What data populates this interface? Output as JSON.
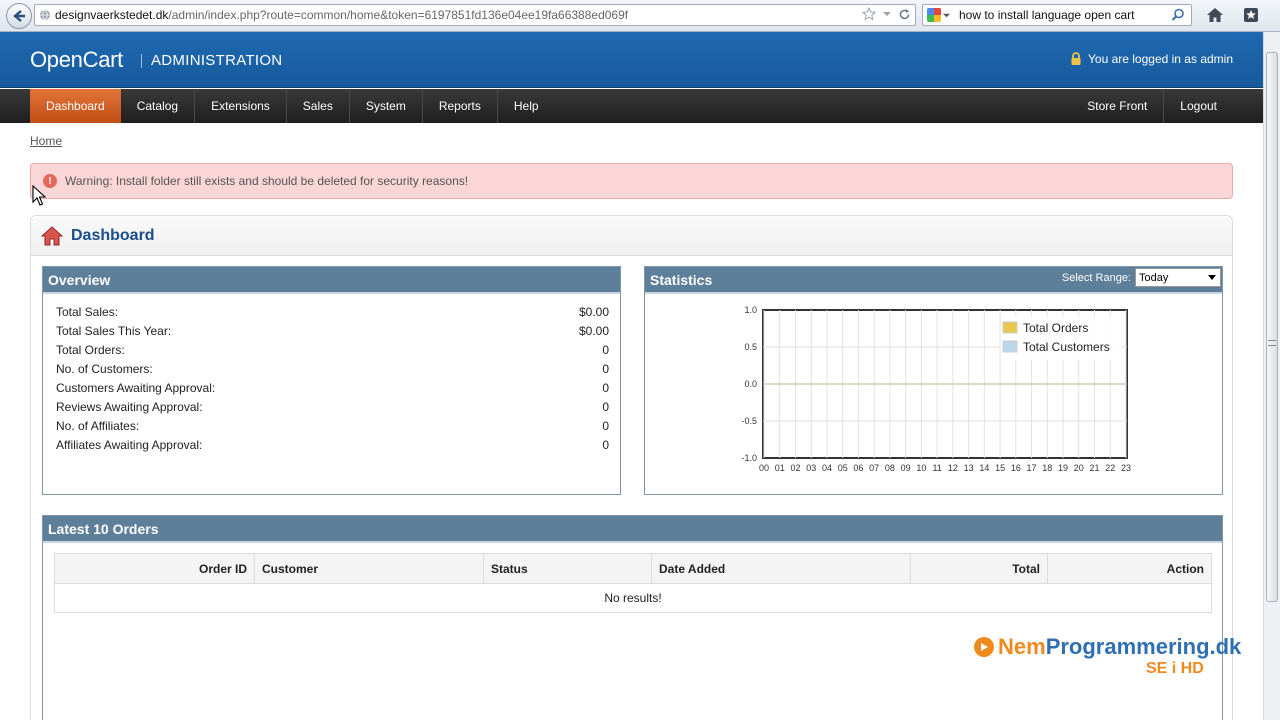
{
  "browser": {
    "url_domain": "designvaerkstedet.dk",
    "url_path": "/admin/index.php?route=common/home&token=6197851fd136e04ee19fa66388ed069f",
    "search_text": "how to install language open cart"
  },
  "header": {
    "logo": "OpenCart",
    "admin": "ADMINISTRATION",
    "login_text": "You are logged in as admin"
  },
  "menu": {
    "left": [
      "Dashboard",
      "Catalog",
      "Extensions",
      "Sales",
      "System",
      "Reports",
      "Help"
    ],
    "right": [
      "Store Front",
      "Logout"
    ],
    "active": "Dashboard"
  },
  "breadcrumb": "Home",
  "warning": "Warning: Install folder still exists and should be deleted for security reasons!",
  "dashboard": {
    "title": "Dashboard"
  },
  "overview": {
    "title": "Overview",
    "rows": [
      {
        "label": "Total Sales:",
        "value": "$0.00"
      },
      {
        "label": "Total Sales This Year:",
        "value": "$0.00"
      },
      {
        "label": "Total Orders:",
        "value": "0"
      },
      {
        "label": "No. of Customers:",
        "value": "0"
      },
      {
        "label": "Customers Awaiting Approval:",
        "value": "0"
      },
      {
        "label": "Reviews Awaiting Approval:",
        "value": "0"
      },
      {
        "label": "No. of Affiliates:",
        "value": "0"
      },
      {
        "label": "Affiliates Awaiting Approval:",
        "value": "0"
      }
    ]
  },
  "statistics": {
    "title": "Statistics",
    "range_label": "Select Range:",
    "range_value": "Today"
  },
  "chart_data": {
    "type": "line",
    "x": [
      "00",
      "01",
      "02",
      "03",
      "04",
      "05",
      "06",
      "07",
      "08",
      "09",
      "10",
      "11",
      "12",
      "13",
      "14",
      "15",
      "16",
      "17",
      "18",
      "19",
      "20",
      "21",
      "22",
      "23"
    ],
    "series": [
      {
        "name": "Total Orders",
        "color": "#e8c84c",
        "values": [
          0,
          0,
          0,
          0,
          0,
          0,
          0,
          0,
          0,
          0,
          0,
          0,
          0,
          0,
          0,
          0,
          0,
          0,
          0,
          0,
          0,
          0,
          0,
          0
        ]
      },
      {
        "name": "Total Customers",
        "color": "#b8d6ec",
        "values": [
          0,
          0,
          0,
          0,
          0,
          0,
          0,
          0,
          0,
          0,
          0,
          0,
          0,
          0,
          0,
          0,
          0,
          0,
          0,
          0,
          0,
          0,
          0,
          0
        ]
      }
    ],
    "yticks": [
      "1.0",
      "0.5",
      "0.0",
      "-0.5",
      "-1.0"
    ],
    "ylim": [
      -1,
      1
    ],
    "grid": true,
    "legend": "top-right"
  },
  "orders": {
    "title": "Latest 10 Orders",
    "columns": [
      "Order ID",
      "Customer",
      "Status",
      "Date Added",
      "Total",
      "Action"
    ],
    "empty": "No results!"
  },
  "watermark": {
    "main_a": "Nem",
    "main_b": "Programmering.dk",
    "sub": "SE i HD"
  },
  "colors": {
    "header_blue": "#1f6ab2",
    "menu_active": "#d15f22",
    "panel_head": "#5e7f99",
    "warning_bg": "#fbd6d6"
  }
}
